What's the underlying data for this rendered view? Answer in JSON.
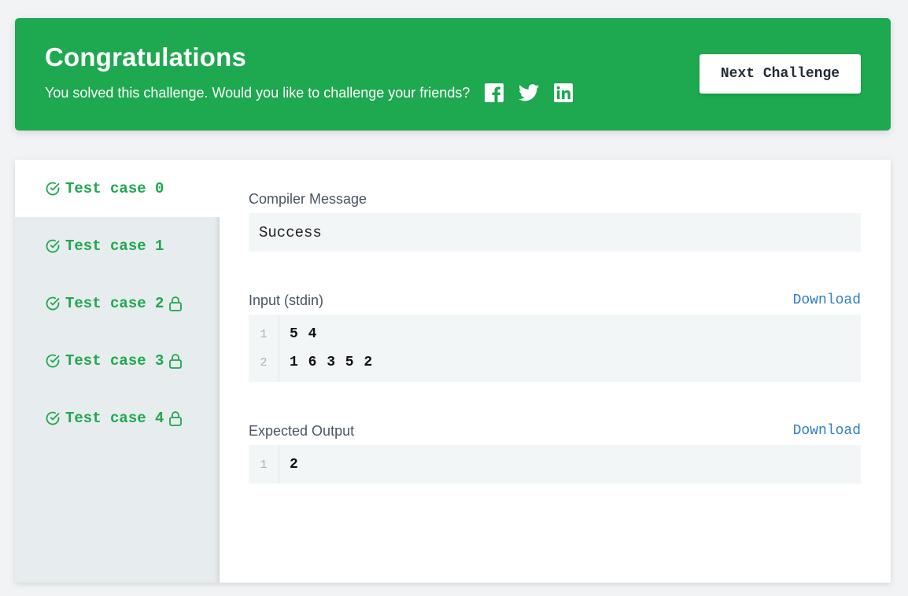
{
  "banner": {
    "title": "Congratulations",
    "subtitle": "You solved this challenge. Would you like to challenge your friends?",
    "social": [
      "facebook-icon",
      "twitter-icon",
      "linkedin-icon"
    ],
    "next_button": "Next Challenge",
    "color": "#1ea84f"
  },
  "tests": [
    {
      "label": "Test case 0",
      "locked": false,
      "active": true
    },
    {
      "label": "Test case 1",
      "locked": false,
      "active": false
    },
    {
      "label": "Test case 2",
      "locked": true,
      "active": false
    },
    {
      "label": "Test case 3",
      "locked": true,
      "active": false
    },
    {
      "label": "Test case 4",
      "locked": true,
      "active": false
    }
  ],
  "compiler": {
    "label": "Compiler Message",
    "message": "Success"
  },
  "input": {
    "label": "Input (stdin)",
    "download": "Download",
    "lines": [
      {
        "n": "1",
        "text": "5 4"
      },
      {
        "n": "2",
        "text": "1 6 3 5 2"
      }
    ]
  },
  "expected": {
    "label": "Expected Output",
    "download": "Download",
    "lines": [
      {
        "n": "1",
        "text": "2"
      }
    ]
  }
}
